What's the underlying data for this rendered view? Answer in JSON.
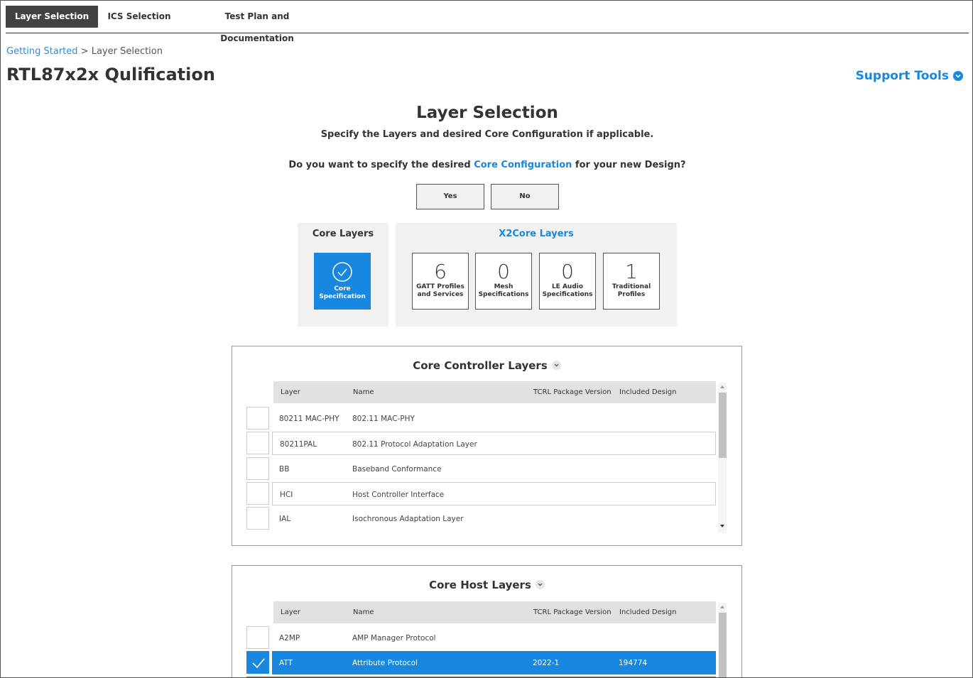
{
  "tabs": [
    {
      "label": "Layer Selection",
      "active": true
    },
    {
      "label": "ICS Selection",
      "active": false
    },
    {
      "label": "Test Plan and Documentation",
      "active": false
    }
  ],
  "breadcrumb": {
    "link": "Getting Started",
    "separator": ">",
    "current": "Layer Selection"
  },
  "page_title": "RTL87x2x Qulification",
  "support_tools": "Support Tools",
  "section": {
    "title": "Layer Selection",
    "subtitle": "Specify the Layers and desired Core Configuration if applicable.",
    "question_pre": "Do you want to specify the desired",
    "question_link": "Core Configuration",
    "question_post": "for your new Design?"
  },
  "buttons": {
    "yes": "Yes",
    "no": "No"
  },
  "core_layers": {
    "title": "Core Layers",
    "tile_line1": "Core",
    "tile_line2": "Specification",
    "icon": "check-circle-icon"
  },
  "x2core_layers": {
    "title": "X2Core Layers",
    "tiles": [
      {
        "count": "6",
        "line1": "GATT Profiles",
        "line2": "and Services"
      },
      {
        "count": "0",
        "line1": "Mesh",
        "line2": "Specifications"
      },
      {
        "count": "0",
        "line1": "LE Audio",
        "line2": "Specifications"
      },
      {
        "count": "1",
        "line1": "Traditional",
        "line2": "Profiles"
      }
    ]
  },
  "table_headers": {
    "layer": "Layer",
    "name": "Name",
    "tcrl": "TCRL Package Version",
    "design": "Included Design"
  },
  "controller": {
    "title": "Core Controller Layers",
    "rows": [
      {
        "layer": "80211 MAC-PHY",
        "name": "802.11 MAC-PHY",
        "tcrl": "",
        "design": "",
        "checked": false
      },
      {
        "layer": "80211PAL",
        "name": "802.11 Protocol Adaptation Layer",
        "tcrl": "",
        "design": "",
        "checked": false
      },
      {
        "layer": "BB",
        "name": "Baseband Conformance",
        "tcrl": "",
        "design": "",
        "checked": false
      },
      {
        "layer": "HCI",
        "name": "Host Controller Interface",
        "tcrl": "",
        "design": "",
        "checked": false
      },
      {
        "layer": "IAL",
        "name": "Isochronous Adaptation Layer",
        "tcrl": "",
        "design": "",
        "checked": false
      }
    ]
  },
  "host": {
    "title": "Core Host Layers",
    "rows": [
      {
        "layer": "A2MP",
        "name": "AMP Manager Protocol",
        "tcrl": "",
        "design": "",
        "checked": false
      },
      {
        "layer": "ATT",
        "name": "Attribute Protocol",
        "tcrl": "2022-1",
        "design": "194774",
        "checked": true
      }
    ]
  },
  "colors": {
    "accent": "#1787e0",
    "active_tab": "#424242",
    "panel_bg": "#f1f1f1"
  }
}
